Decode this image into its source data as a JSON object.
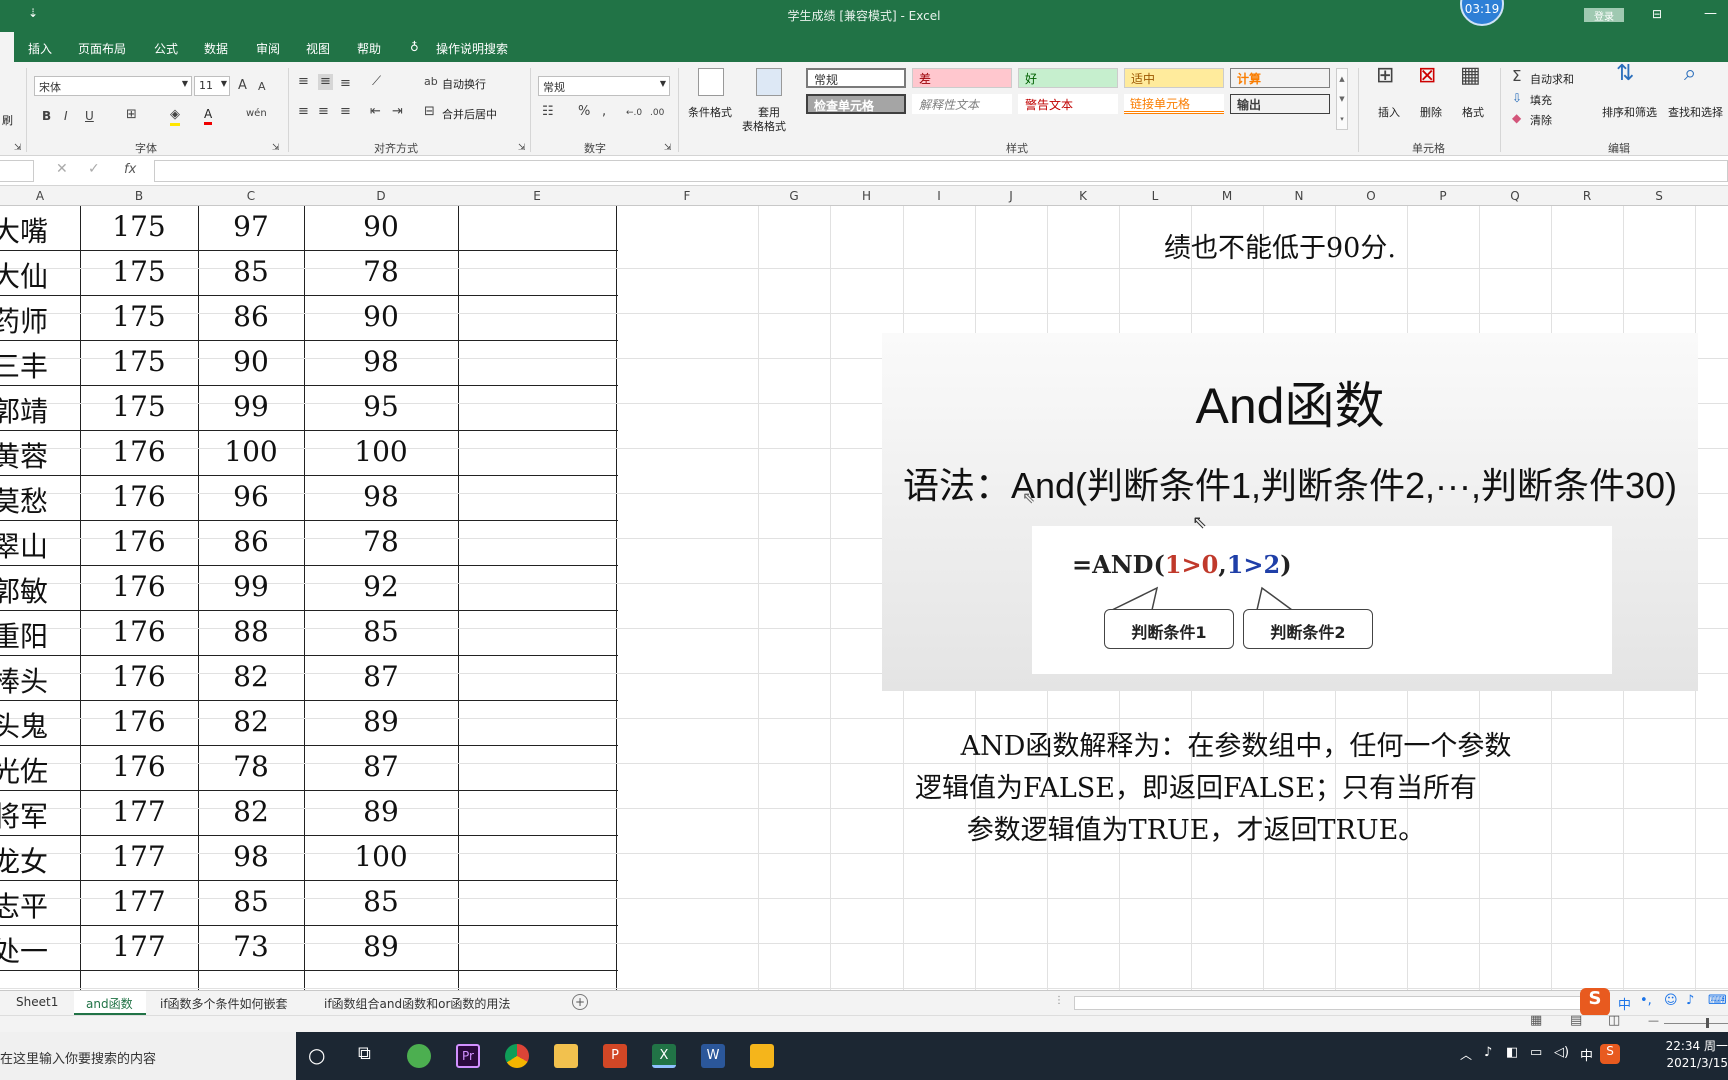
{
  "window": {
    "title": "学生成绩  [兼容模式]  -  Excel",
    "clock_badge": "03:19",
    "login_label": "登录"
  },
  "menu": {
    "items": [
      "插入",
      "页面布局",
      "公式",
      "数据",
      "审阅",
      "视图",
      "帮助"
    ],
    "tell_me": "操作说明搜索"
  },
  "ribbon": {
    "font_name": "宋体",
    "font_size": "11",
    "font_group": "字体",
    "align_group": "对齐方式",
    "wrap_text": "自动换行",
    "merge_center": "合并后居中",
    "number_format": "常规",
    "number_group": "数字",
    "cond_format": "条件格式",
    "table_format_1": "套用",
    "table_format_2": "表格格式",
    "styles": {
      "normal": "常规",
      "bad": "差",
      "good": "好",
      "neutral": "适中",
      "calc": "计算",
      "check": "检查单元格",
      "explain": "解释性文本",
      "warning": "警告文本",
      "linked": "链接单元格",
      "output": "输出"
    },
    "styles_group": "样式",
    "insert": "插入",
    "delete": "删除",
    "format": "格式",
    "cells_group": "单元格",
    "autosum": "自动求和",
    "fill": "填充",
    "clear": "清除",
    "sort_filter": "排序和筛选",
    "find_select": "查找和选择",
    "edit_group": "编辑",
    "left_partial": "刷"
  },
  "formula_bar": {
    "fx": "fx",
    "value": ""
  },
  "columns": [
    "A",
    "B",
    "C",
    "D",
    "E",
    "F",
    "G",
    "H",
    "I",
    "J",
    "K",
    "L",
    "M",
    "N",
    "O",
    "P",
    "Q",
    "R",
    "S"
  ],
  "rows": [
    [
      "大嘴",
      "175",
      "97",
      "90"
    ],
    [
      "大仙",
      "175",
      "85",
      "78"
    ],
    [
      "药师",
      "175",
      "86",
      "90"
    ],
    [
      "三丰",
      "175",
      "90",
      "98"
    ],
    [
      "郭靖",
      "175",
      "99",
      "95"
    ],
    [
      "黄蓉",
      "176",
      "100",
      "100"
    ],
    [
      "莫愁",
      "176",
      "96",
      "98"
    ],
    [
      "翠山",
      "176",
      "86",
      "78"
    ],
    [
      "郭敏",
      "176",
      "99",
      "92"
    ],
    [
      "重阳",
      "176",
      "88",
      "85"
    ],
    [
      "棒头",
      "176",
      "82",
      "87"
    ],
    [
      "头鬼",
      "176",
      "82",
      "89"
    ],
    [
      "光佐",
      "176",
      "78",
      "87"
    ],
    [
      "将军",
      "177",
      "82",
      "89"
    ],
    [
      "龙女",
      "177",
      "98",
      "100"
    ],
    [
      "志平",
      "177",
      "85",
      "85"
    ],
    [
      "处一",
      "177",
      "73",
      "89"
    ]
  ],
  "note_top": "绩也不能低于90分.",
  "slide": {
    "title": "And函数",
    "syntax": "语法：And(判断条件1,判断条件2,···,判断条件30)",
    "formula": {
      "prefix": "=AND(",
      "c1": "1>0",
      "comma": ",",
      "c2": "1>2",
      "suffix": ")"
    },
    "callout1": "判断条件1",
    "callout2": "判断条件2",
    "colors": {
      "red": "#c0392b",
      "blue": "#1f3fa8"
    }
  },
  "explanation": [
    "AND函数解释为：在参数组中，任何一个参数",
    "逻辑值为FALSE，即返回FALSE；只有当所有",
    "参数逻辑值为TRUE，才返回TRUE。"
  ],
  "sheet_tabs": [
    "Sheet1",
    "and函数",
    "if函数多个条件如何嵌套",
    "if函数组合and函数和or函数的用法"
  ],
  "ime": {
    "lang": "中"
  },
  "taskbar": {
    "search_placeholder": "在这里输入你要搜索的内容",
    "time": "22:34 周一",
    "date": "2021/3/15",
    "lang": "中"
  },
  "accent": "#217346"
}
